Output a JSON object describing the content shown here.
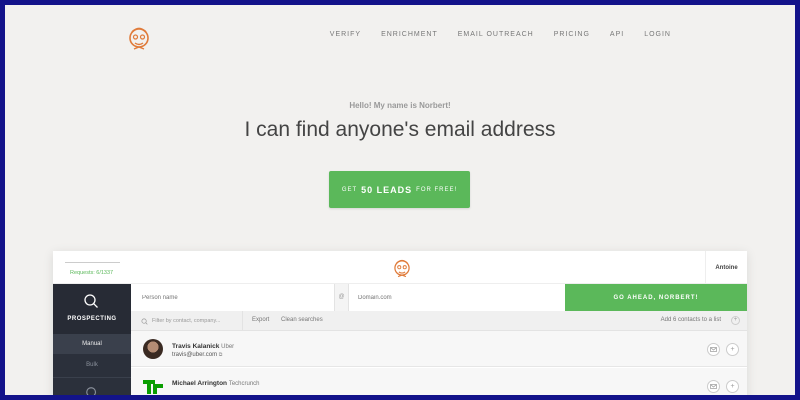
{
  "colors": {
    "accent": "#5bb85a",
    "frame": "#13138a",
    "background": "#f2f1ef",
    "sidebar": "#2b303b"
  },
  "header": {
    "logo_icon": "norbert-mascot-icon",
    "nav": [
      {
        "label": "VERIFY"
      },
      {
        "label": "ENRICHMENT"
      },
      {
        "label": "EMAIL OUTREACH"
      },
      {
        "label": "PRICING"
      },
      {
        "label": "API"
      },
      {
        "label": "LOGIN"
      }
    ]
  },
  "hero": {
    "subtitle": "Hello! My name is Norbert!",
    "title": "I can find anyone's email address",
    "cta": {
      "prefix": "GET",
      "main": "50 LEADS",
      "suffix": "FOR FREE!"
    }
  },
  "app": {
    "requests": "Requests: 6/1337",
    "user": "Antoine",
    "sidebar": {
      "active": "PROSPECTING",
      "active_icon": "search-icon",
      "items": [
        {
          "label": "Manual"
        },
        {
          "label": "Bulk"
        }
      ]
    },
    "search": {
      "person_placeholder": "Person name",
      "at": "@",
      "domain_placeholder": "Domain.com",
      "go_label": "GO AHEAD, NORBERT!"
    },
    "filter": {
      "placeholder": "Filter by contact, company...",
      "export": "Export",
      "clean": "Clean searches",
      "add_list": "Add 6 contacts to a list",
      "add_list_btn": "+"
    },
    "leads": [
      {
        "name": "Travis Kalanick",
        "company": "Uber",
        "email": "travis@uber.com",
        "mail_icon": "mail-icon",
        "plus": "+"
      },
      {
        "name": "Michael Arrington",
        "company": "Techcrunch",
        "email": "",
        "mail_icon": "mail-icon",
        "plus": "+"
      }
    ]
  }
}
